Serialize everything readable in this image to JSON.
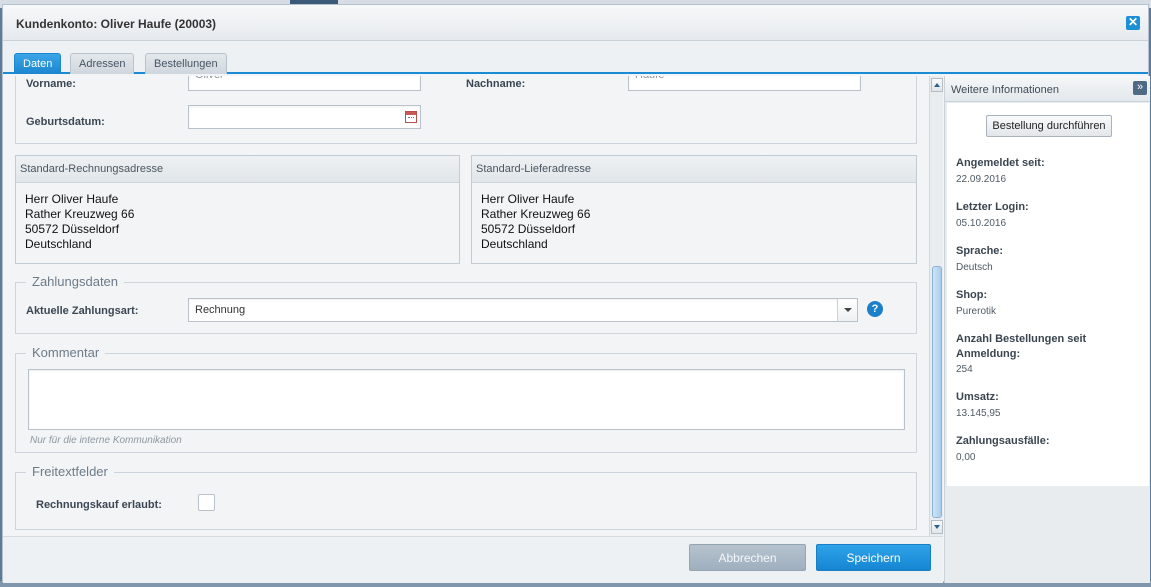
{
  "window": {
    "title": "Kundenkonto: Oliver Haufe (20003)",
    "close_icon": "close-icon"
  },
  "tabs": [
    {
      "label": "Daten",
      "active": true
    },
    {
      "label": "Adressen",
      "active": false
    },
    {
      "label": "Bestellungen",
      "active": false
    }
  ],
  "personal": {
    "firstname_label": "Vorname:",
    "firstname_value": "Oliver",
    "lastname_label": "Nachname:",
    "lastname_value": "Haufe",
    "birthday_label": "Geburtsdatum:",
    "birthday_value": ""
  },
  "billing_address": {
    "header": "Standard-Rechnungsadresse",
    "lines": [
      "Herr Oliver Haufe",
      "Rather Kreuzweg 66",
      "50572 Düsseldorf",
      "Deutschland"
    ]
  },
  "shipping_address": {
    "header": "Standard-Lieferadresse",
    "lines": [
      "Herr Oliver Haufe",
      "Rather Kreuzweg 66",
      "50572 Düsseldorf",
      "Deutschland"
    ]
  },
  "payment": {
    "legend": "Zahlungsdaten",
    "label": "Aktuelle Zahlungsart:",
    "selected": "Rechnung",
    "help": "?"
  },
  "comment": {
    "legend": "Kommentar",
    "value": "",
    "hint": "Nur für die interne Kommunikation"
  },
  "freetext": {
    "legend": "Freitextfelder",
    "invoice_purchase_label": "Rechnungskauf erlaubt:",
    "invoice_purchase_checked": false
  },
  "footer": {
    "cancel_label": "Abbrechen",
    "save_label": "Speichern"
  },
  "sidebar": {
    "title": "Weitere Informationen",
    "collapse": "»",
    "order_button": "Bestellung durchführen",
    "items": [
      {
        "label": "Angemeldet seit:",
        "value": "22.09.2016"
      },
      {
        "label": "Letzter Login:",
        "value": "05.10.2016"
      },
      {
        "label": "Sprache:",
        "value": "Deutsch"
      },
      {
        "label": "Shop:",
        "value": "Purerotik"
      },
      {
        "label": "Anzahl Bestellungen seit Anmeldung:",
        "value": "254"
      },
      {
        "label": "Umsatz:",
        "value": "13.145,95"
      },
      {
        "label": "Zahlungsausfälle:",
        "value": "0,00"
      }
    ]
  },
  "colors": {
    "accent": "#1b8cd4",
    "save_button": "#1685d3",
    "cancel_button": "#a8b7c5"
  }
}
